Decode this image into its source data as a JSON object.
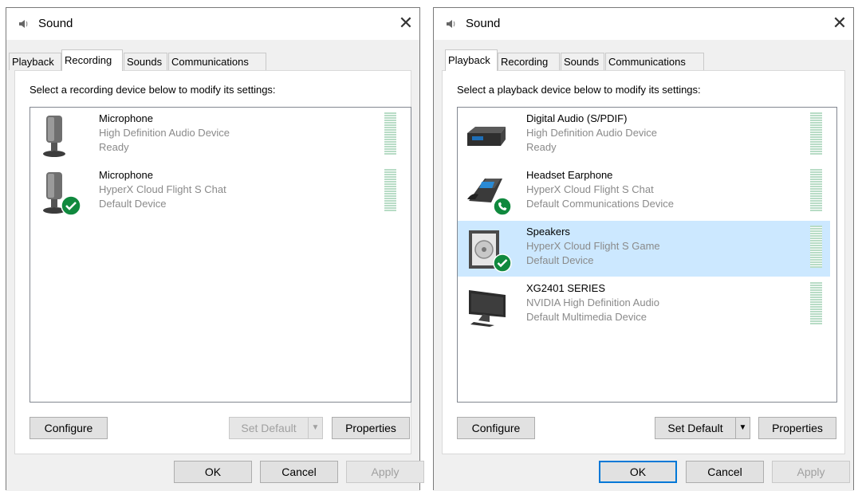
{
  "left": {
    "title": "Sound",
    "tabs": [
      {
        "label": "Playback",
        "active": false
      },
      {
        "label": "Recording",
        "active": true
      },
      {
        "label": "Sounds",
        "active": false
      },
      {
        "label": "Communications",
        "active": false
      }
    ],
    "instruction": "Select a recording device below to modify its settings:",
    "devices": [
      {
        "name": "Microphone",
        "line1": "High Definition Audio Device",
        "line2": "Ready",
        "icon": "microphone-icon",
        "badge": ""
      },
      {
        "name": "Microphone",
        "line1": "HyperX Cloud Flight S Chat",
        "line2": "Default Device",
        "icon": "microphone-icon",
        "badge": "default-check-icon"
      }
    ],
    "buttons": {
      "configure": "Configure",
      "set_default": "Set Default",
      "properties": "Properties"
    },
    "dialog_buttons": {
      "ok": "OK",
      "cancel": "Cancel",
      "apply": "Apply"
    }
  },
  "right": {
    "title": "Sound",
    "tabs": [
      {
        "label": "Playback",
        "active": true
      },
      {
        "label": "Recording",
        "active": false
      },
      {
        "label": "Sounds",
        "active": false
      },
      {
        "label": "Communications",
        "active": false
      }
    ],
    "instruction": "Select a playback device below to modify its settings:",
    "devices": [
      {
        "name": "Digital Audio (S/PDIF)",
        "line1": "High Definition Audio Device",
        "line2": "Ready",
        "icon": "digital-audio-icon",
        "badge": ""
      },
      {
        "name": "Headset Earphone",
        "line1": "HyperX Cloud Flight S Chat",
        "line2": "Default Communications Device",
        "icon": "headset-phone-icon",
        "badge": "phone-badge-icon"
      },
      {
        "name": "Speakers",
        "line1": "HyperX Cloud Flight S Game",
        "line2": "Default Device",
        "icon": "speaker-icon",
        "badge": "default-check-icon",
        "selected": true
      },
      {
        "name": "XG2401 SERIES",
        "line1": "NVIDIA High Definition Audio",
        "line2": "Default Multimedia Device",
        "icon": "monitor-icon",
        "badge": ""
      }
    ],
    "buttons": {
      "configure": "Configure",
      "set_default": "Set Default",
      "properties": "Properties"
    },
    "dialog_buttons": {
      "ok": "OK",
      "cancel": "Cancel",
      "apply": "Apply"
    }
  },
  "colors": {
    "selection": "#cce8ff",
    "default_badge": "#10893e",
    "focus_border": "#0078d7",
    "meter": "#b8dcc6"
  }
}
